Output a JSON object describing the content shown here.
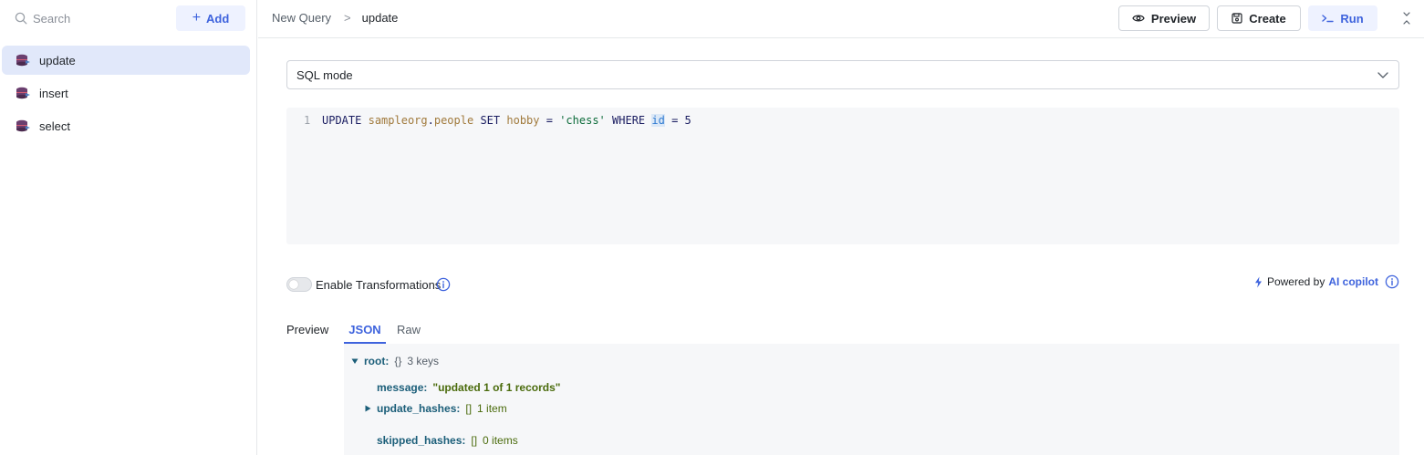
{
  "sidebar": {
    "search": {
      "placeholder": "Search"
    },
    "add_label": "Add",
    "queries": [
      {
        "label": "update",
        "active": true
      },
      {
        "label": "insert",
        "active": false
      },
      {
        "label": "select",
        "active": false
      }
    ]
  },
  "header": {
    "breadcrumb_root": "New Query",
    "breadcrumb_separator": ">",
    "breadcrumb_current": "update",
    "preview_label": "Preview",
    "create_label": "Create",
    "run_label": "Run"
  },
  "editor": {
    "mode_label": "SQL mode",
    "line_number": "1",
    "tokens": {
      "t1": "UPDATE",
      "t2": "sampleorg",
      "t3": ".",
      "t4": "people",
      "t5": "SET",
      "t6": "hobby",
      "t7": "=",
      "t8": "'chess'",
      "t9": "WHERE",
      "t10": "id",
      "t11": "=",
      "t12": "5"
    }
  },
  "transformations": {
    "label": "Enable Transformations",
    "enabled": false
  },
  "copilot": {
    "prefix": "Powered by",
    "link": "AI copilot"
  },
  "preview": {
    "label": "Preview",
    "tabs": {
      "json": "JSON",
      "raw": "Raw"
    },
    "json": {
      "root_key": "root:",
      "root_brace": "{}",
      "root_meta": "3 keys",
      "message_key": "message:",
      "message_value": "\"updated 1 of 1 records\"",
      "update_key": "update_hashes:",
      "update_brace": "[]",
      "update_meta": "1 item",
      "skipped_key": "skipped_hashes:",
      "skipped_brace": "[]",
      "skipped_meta": "0 items"
    }
  },
  "colors": {
    "accent": "#3e63dd",
    "active_item_bg": "#e1e8fa",
    "run_button_bg": "#eef2ff"
  },
  "icons": {
    "search": "search-icon",
    "add": "plus-icon",
    "query": "database-icon",
    "preview": "eye-icon",
    "create": "save-icon",
    "run": "terminal-icon",
    "collapse": "collapse-icon",
    "select": "chevron-down-icon",
    "info": "info-icon",
    "copilot": "lightning-icon"
  }
}
